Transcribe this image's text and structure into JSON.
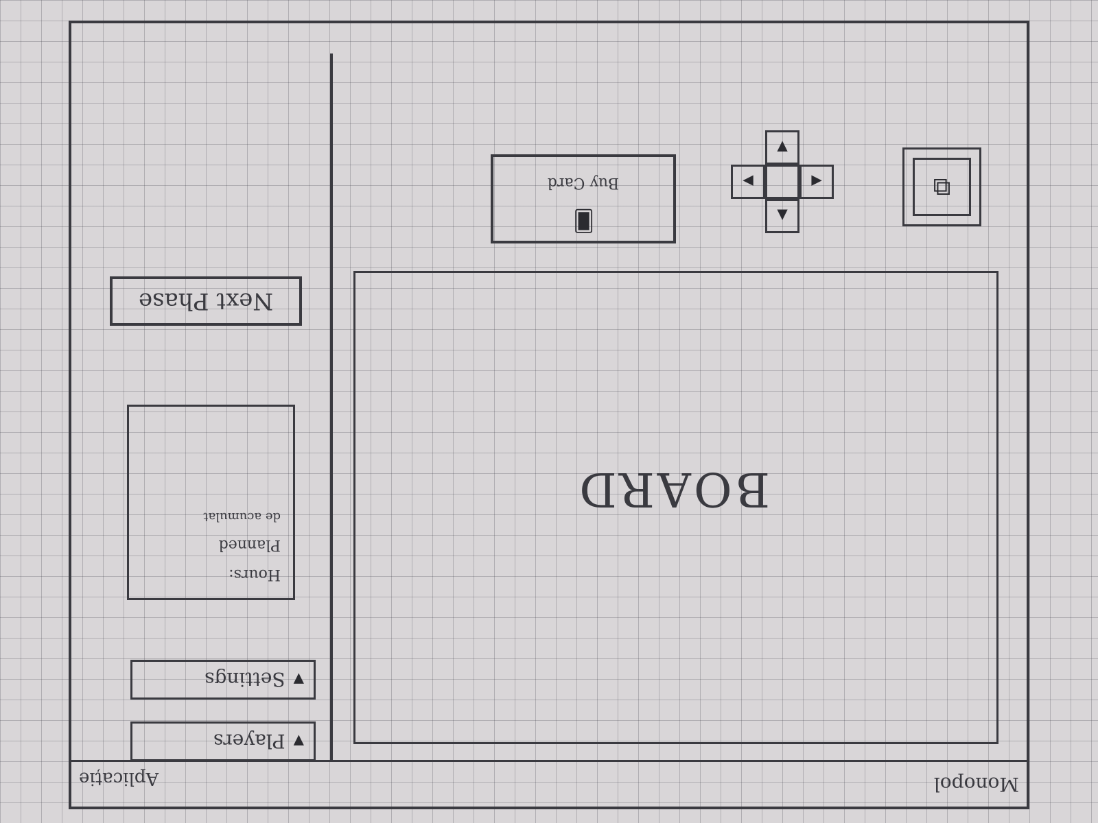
{
  "window": {
    "title": "Monopol",
    "app_title": "Aplicație"
  },
  "board": {
    "label": "BOARD"
  },
  "dpad": {
    "up": "▲",
    "down": "▼",
    "left": "◀",
    "right": "▶"
  },
  "buy_card": {
    "label": "Buy Card",
    "icon": "card-icon"
  },
  "corner_button": {
    "icon": "zoom-icon"
  },
  "side_panel": {
    "players_label": "Players",
    "settings_label": "Settings",
    "info": {
      "line1": "Hours:",
      "line2": "Planned",
      "line3": "de acumulat"
    },
    "next_phase_label": "Next Phase"
  }
}
